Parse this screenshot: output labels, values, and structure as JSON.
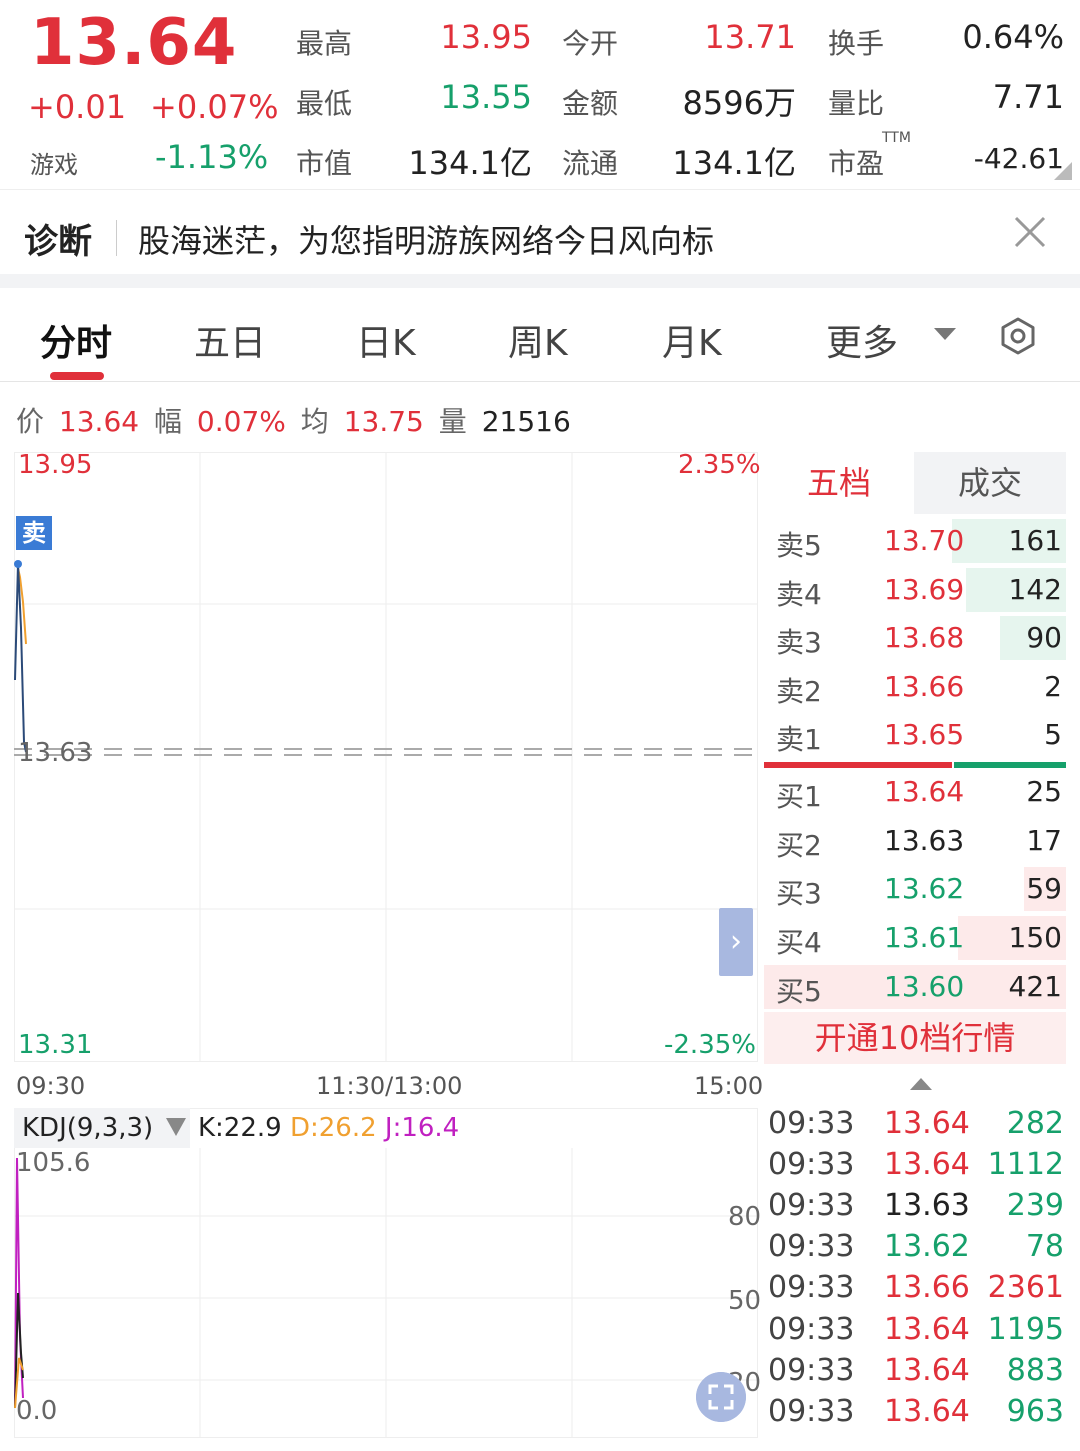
{
  "quote": {
    "last_price": "13.64",
    "change_abs": "+0.01",
    "change_pct": "+0.07%",
    "sector_name": "游戏",
    "sector_change": "-1.13%",
    "stats": {
      "high_label": "最高",
      "high": "13.95",
      "open_label": "今开",
      "open": "13.71",
      "turnover_label": "换手",
      "turnover": "0.64%",
      "low_label": "最低",
      "low": "13.55",
      "amount_label": "金额",
      "amount": "8596万",
      "volume_ratio_label": "量比",
      "volume_ratio": "7.71",
      "mktcap_label": "市值",
      "mktcap": "134.1亿",
      "float_label": "流通",
      "float": "134.1亿",
      "pe_label": "市盈",
      "pe_ttm_tag": "TTM",
      "pe": "-42.61"
    }
  },
  "diagnosis": {
    "title": "诊断",
    "text": "股海迷茫，为您指明游族网络今日风向标"
  },
  "tabs": [
    {
      "label": "分时"
    },
    {
      "label": "五日"
    },
    {
      "label": "日K"
    },
    {
      "label": "周K"
    },
    {
      "label": "月K"
    },
    {
      "label": "更多"
    }
  ],
  "info_line": {
    "price_label": "价",
    "price": "13.64",
    "range_label": "幅",
    "range": "0.07%",
    "avg_label": "均",
    "avg": "13.75",
    "vol_label": "量",
    "vol": "21516"
  },
  "intraday_chart": {
    "y_high": "13.95",
    "y_low": "13.31",
    "pct_high": "2.35%",
    "pct_low": "-2.35%",
    "prev_close": "13.63",
    "sell_tag": "卖",
    "x_labels": [
      "09:30",
      "11:30/13:00",
      "15:00"
    ]
  },
  "orderbook": {
    "tab_five": "五档",
    "tab_trades": "成交",
    "asks": [
      {
        "label": "卖5",
        "price": "13.70",
        "vol": "161"
      },
      {
        "label": "卖4",
        "price": "13.69",
        "vol": "142"
      },
      {
        "label": "卖3",
        "price": "13.68",
        "vol": "90"
      },
      {
        "label": "卖2",
        "price": "13.66",
        "vol": "2"
      },
      {
        "label": "卖1",
        "price": "13.65",
        "vol": "5"
      }
    ],
    "bids": [
      {
        "label": "买1",
        "price": "13.64",
        "vol": "25"
      },
      {
        "label": "买2",
        "price": "13.63",
        "vol": "17"
      },
      {
        "label": "买3",
        "price": "13.62",
        "vol": "59"
      },
      {
        "label": "买4",
        "price": "13.61",
        "vol": "150"
      },
      {
        "label": "买5",
        "price": "13.60",
        "vol": "421"
      }
    ],
    "upgrade_text": "开通10档行情"
  },
  "trades": [
    {
      "time": "09:33",
      "price": "13.64",
      "vol": "282"
    },
    {
      "time": "09:33",
      "price": "13.64",
      "vol": "1112"
    },
    {
      "time": "09:33",
      "price": "13.63",
      "vol": "239"
    },
    {
      "time": "09:33",
      "price": "13.62",
      "vol": "78"
    },
    {
      "time": "09:33",
      "price": "13.66",
      "vol": "2361"
    },
    {
      "time": "09:33",
      "price": "13.64",
      "vol": "1195"
    },
    {
      "time": "09:33",
      "price": "13.64",
      "vol": "883"
    },
    {
      "time": "09:33",
      "price": "13.64",
      "vol": "963"
    }
  ],
  "kdj": {
    "name": "KDJ(9,3,3)",
    "k": "K:22.9",
    "d": "D:26.2",
    "j": "J:16.4",
    "y_max": "105.6",
    "y_min": "0.0",
    "levels": [
      "80",
      "50",
      "20"
    ]
  },
  "colors": {
    "up": "#e0303a",
    "down": "#16a06b",
    "k_line": "#222222",
    "d_line": "#f0a030",
    "j_line": "#c020c0",
    "accent": "#3a7bd5"
  }
}
